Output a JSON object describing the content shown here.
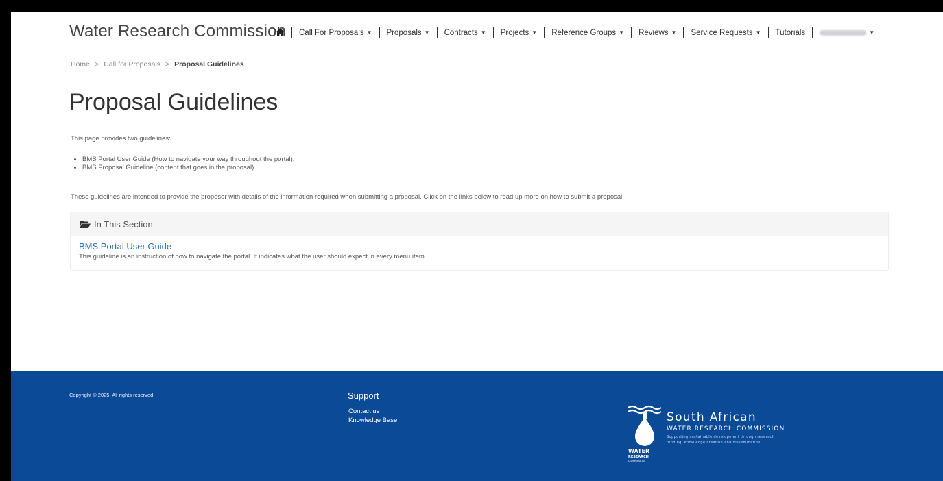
{
  "header": {
    "brand": "Water Research Commission",
    "nav": [
      {
        "label": "Call For Proposals",
        "dropdown": true
      },
      {
        "label": "Proposals",
        "dropdown": true
      },
      {
        "label": "Contracts",
        "dropdown": true
      },
      {
        "label": "Projects",
        "dropdown": true
      },
      {
        "label": "Reference Groups",
        "dropdown": true
      },
      {
        "label": "Reviews",
        "dropdown": true
      },
      {
        "label": "Service Requests",
        "dropdown": true
      },
      {
        "label": "Tutorials",
        "dropdown": false
      }
    ]
  },
  "breadcrumb": {
    "home": "Home",
    "parent": "Call for Proposals",
    "current": "Proposal Guidelines",
    "separator": ">"
  },
  "main": {
    "title": "Proposal Guidelines",
    "intro": "This page provides two guidelines:",
    "bullets": [
      "BMS Portal User Guide (How to navigate your way throughout the portal).",
      "BMS Proposal Guideline (content that goes in the proposal)."
    ],
    "description": "These guidelines are intended to provide the proposer with details of the information required when submitting a proposal. Click on the links below to read up more on how to submit a proposal.",
    "section": {
      "heading": "In This Section",
      "link_title": "BMS Portal User Guide",
      "link_description": "This guideline is an instruction of how to navigate the portal. It indicates what the user should expect in every menu item."
    }
  },
  "footer": {
    "copyright": "Copyright © 2025. All rights reserved.",
    "support_title": "Support",
    "support_links": [
      "Contact us",
      "Knowledge Base"
    ],
    "logo": {
      "line1": "South African",
      "line2": "WATER RESEARCH COMMISSION",
      "tagline1": "Supporting sustainable development through research",
      "tagline2": "funding, knowledge creation and dissemination",
      "mark_text1": "WATER",
      "mark_text2": "RESEARCH",
      "mark_text3": "COMMISSION"
    }
  },
  "colors": {
    "footer_bg": "#0a4a96",
    "link": "#2a6fb8"
  }
}
